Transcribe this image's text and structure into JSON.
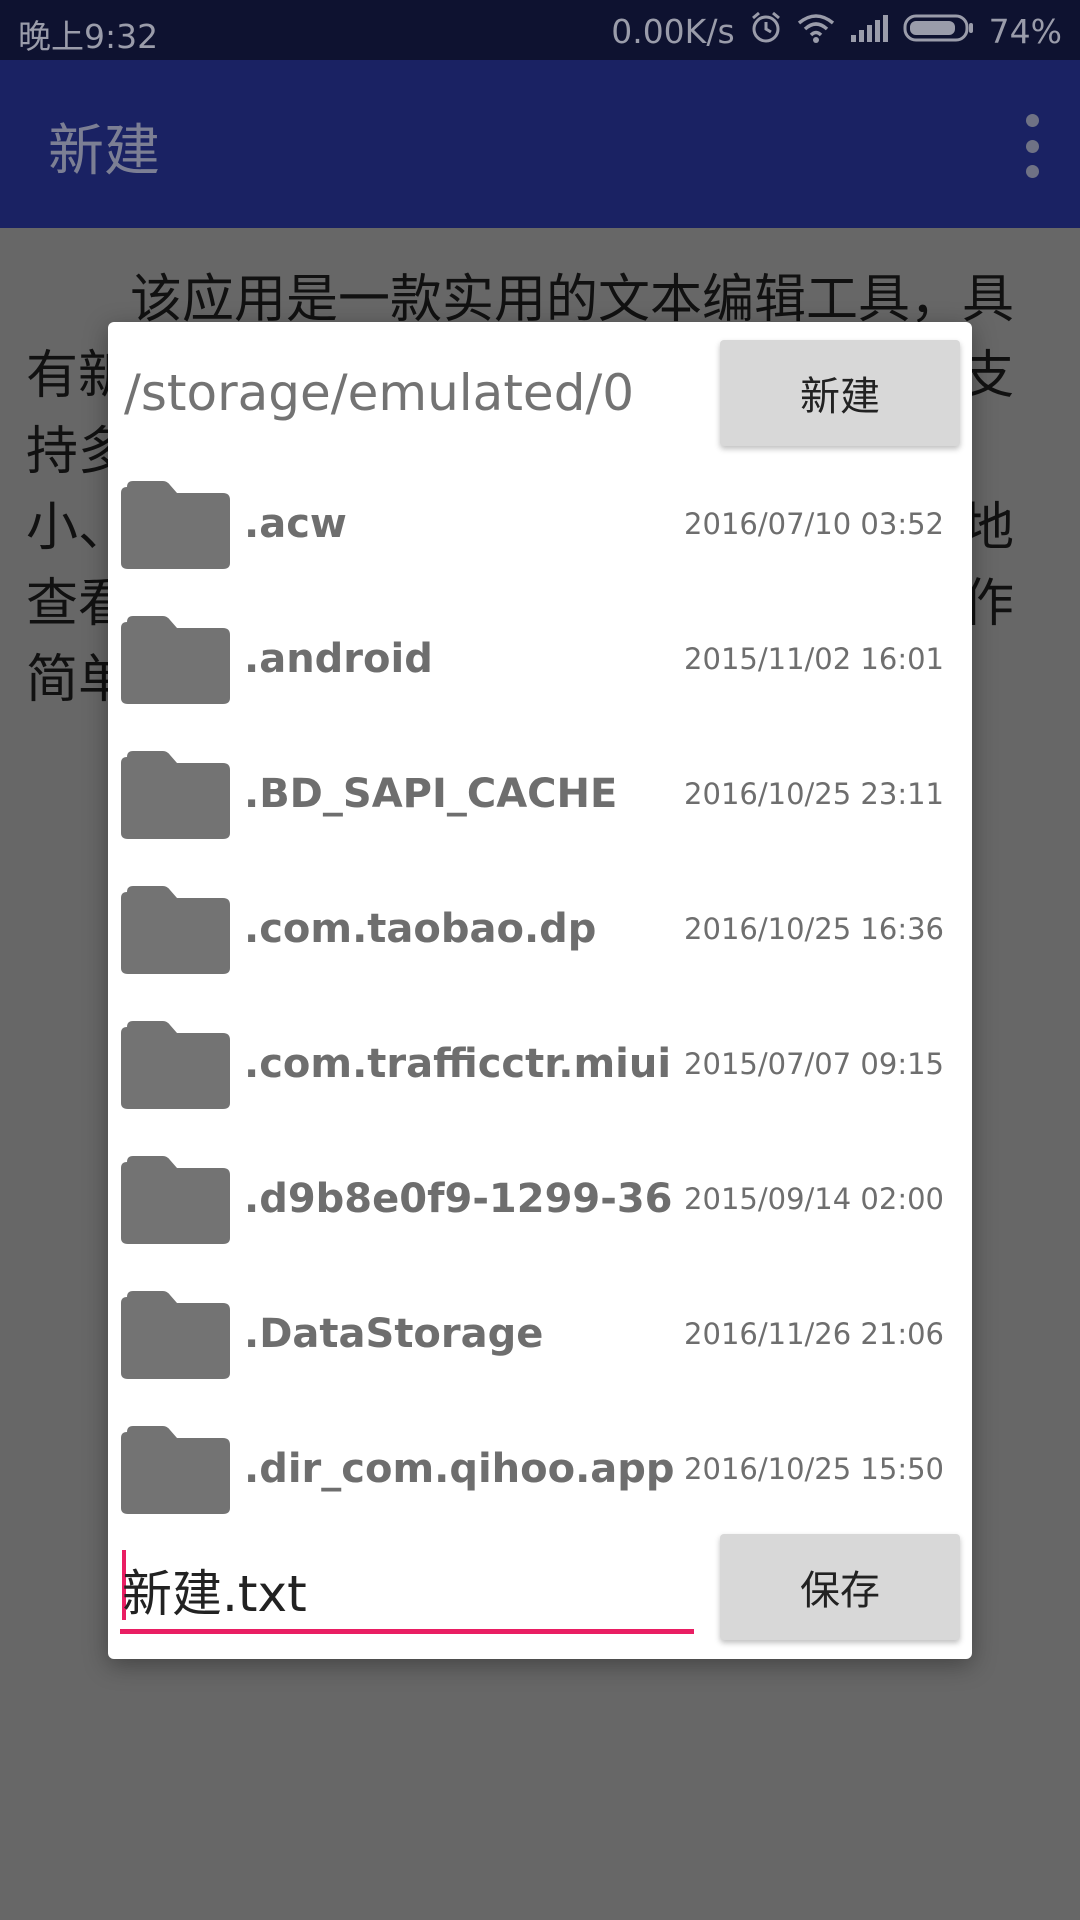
{
  "status_bar": {
    "time": "晚上9:32",
    "speed": "0.00K/s",
    "battery": "74%",
    "icons": [
      "alarm-icon",
      "wifi-icon",
      "signal-icon",
      "battery-icon"
    ]
  },
  "app_bar": {
    "title": "新建",
    "overflow_icon": "more-vert-icon"
  },
  "document": {
    "text": "该应用是一款实用的文本编辑工具，具有新建、打开、编辑、保存等基本功能，支持多种编码格式、多种文件类型、字体大小、字体颜色、背景颜色设置。可以方便地查看、编辑手机中的文件，界面简洁，操作简单。"
  },
  "dialog": {
    "path": "/storage/emulated/0",
    "new_button": "新建",
    "save_button": "保存",
    "filename_value": "新建.txt",
    "files": [
      {
        "name": ".acw",
        "date": "2016/07/10 03:52"
      },
      {
        "name": ".android",
        "date": "2015/11/02 16:01"
      },
      {
        "name": ".BD_SAPI_CACHE",
        "date": "2016/10/25 23:11"
      },
      {
        "name": ".com.taobao.dp",
        "date": "2016/10/25 16:36"
      },
      {
        "name": ".com.trafficctr.miui",
        "date": "2015/07/07 09:15"
      },
      {
        "name": ".d9b8e0f9-1299-36...",
        "date": "2015/09/14 02:00"
      },
      {
        "name": ".DataStorage",
        "date": "2016/11/26 21:06"
      },
      {
        "name": ".dir_com.qihoo.apps...",
        "date": "2016/10/25 15:50"
      }
    ]
  },
  "colors": {
    "status_bar": "#0e1230",
    "app_bar": "#1a2263",
    "accent": "#e91e63",
    "scrim": "#676767",
    "folder": "#737373"
  }
}
